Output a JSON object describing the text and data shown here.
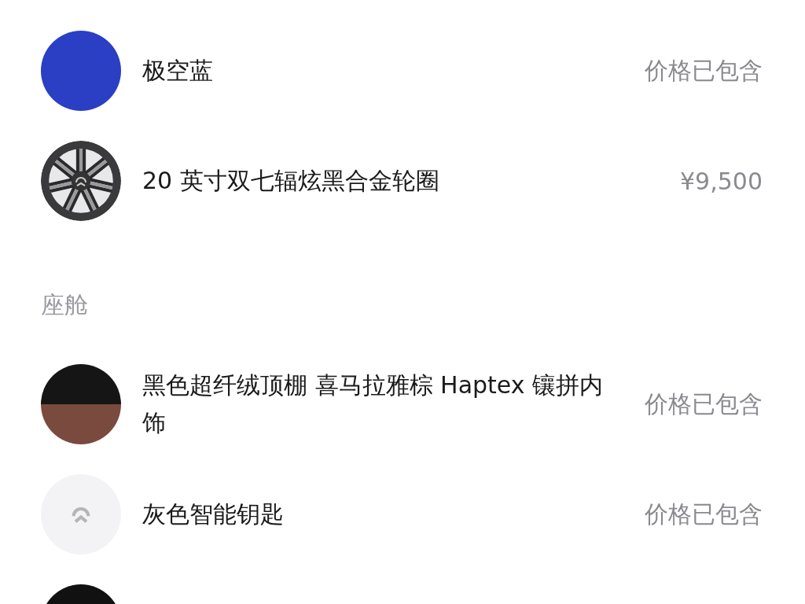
{
  "sections": [
    {
      "items": [
        {
          "kind": "swatch",
          "color": "#2a3fc4",
          "name": "极空蓝",
          "price": "价格已包含"
        },
        {
          "kind": "wheel",
          "name": "20 英寸双七辐炫黑合金轮圈",
          "price": "¥9,500"
        }
      ]
    },
    {
      "title": "座舱",
      "items": [
        {
          "kind": "split",
          "name": "黑色超纤绒顶棚 喜马拉雅棕 Haptex 镶拼内饰",
          "price": "价格已包含"
        },
        {
          "kind": "key",
          "name": "灰色智能钥匙",
          "price": "价格已包含"
        },
        {
          "kind": "swatch",
          "color": "#111111"
        }
      ]
    }
  ]
}
